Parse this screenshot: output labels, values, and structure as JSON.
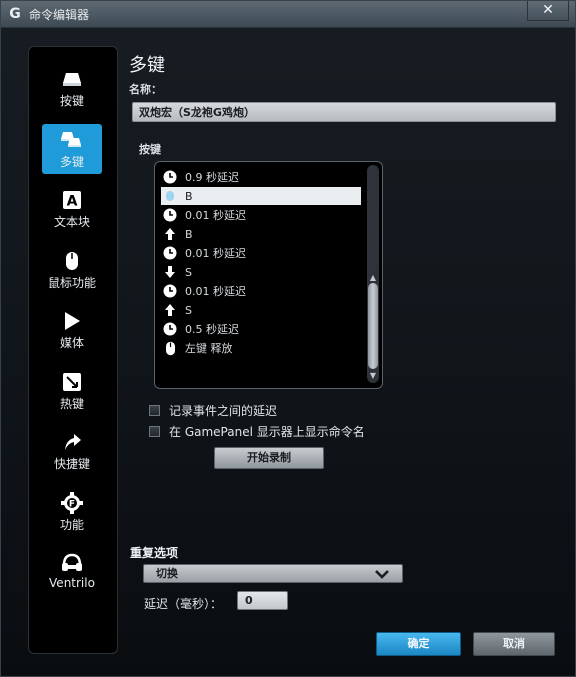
{
  "window": {
    "title": "命令编辑器",
    "close_label": "✕"
  },
  "sidebar": {
    "items": [
      {
        "label": "按键",
        "icon": "key-icon",
        "active": false
      },
      {
        "label": "多键",
        "icon": "multi-key-icon",
        "active": true
      },
      {
        "label": "文本块",
        "icon": "text-block-icon",
        "active": false
      },
      {
        "label": "鼠标功能",
        "icon": "mouse-icon",
        "active": false
      },
      {
        "label": "媒体",
        "icon": "play-icon",
        "active": false
      },
      {
        "label": "热键",
        "icon": "hotkey-icon",
        "active": false
      },
      {
        "label": "快捷键",
        "icon": "shortcut-arrow-icon",
        "active": false
      },
      {
        "label": "功能",
        "icon": "function-gear-icon",
        "active": false
      },
      {
        "label": "Ventrilo",
        "icon": "headset-icon",
        "active": false
      }
    ]
  },
  "main": {
    "section_title": "多键",
    "name_label": "名称：",
    "name_value": "双炮宏（S龙袍G鸡炮）",
    "keys_label": "按键",
    "key_events": [
      {
        "icon": "clock-icon",
        "text": "0.9 秒延迟",
        "selected": false
      },
      {
        "icon": "keystroke-icon",
        "text": "B",
        "selected": true
      },
      {
        "icon": "clock-icon",
        "text": "0.01 秒延迟",
        "selected": false
      },
      {
        "icon": "arrow-up-icon",
        "text": "B",
        "selected": false
      },
      {
        "icon": "clock-icon",
        "text": "0.01 秒延迟",
        "selected": false
      },
      {
        "icon": "arrow-down-icon",
        "text": "S",
        "selected": false
      },
      {
        "icon": "clock-icon",
        "text": "0.01 秒延迟",
        "selected": false
      },
      {
        "icon": "arrow-up-icon",
        "text": "S",
        "selected": false
      },
      {
        "icon": "clock-icon",
        "text": "0.5 秒延迟",
        "selected": false
      },
      {
        "icon": "mouse-icon",
        "text": "左键 释放",
        "selected": false
      }
    ],
    "record_delay_label": "记录事件之间的延迟",
    "gamepanel_label": "在 GamePanel 显示器上显示命令名",
    "start_record_label": "开始录制",
    "repeat_label": "重复选项",
    "repeat_value": "切换",
    "delay_label": "延迟（毫秒）：",
    "delay_value": "0",
    "ok_label": "确定",
    "cancel_label": "取消"
  },
  "colors": {
    "accent": "#1e9bd8"
  }
}
